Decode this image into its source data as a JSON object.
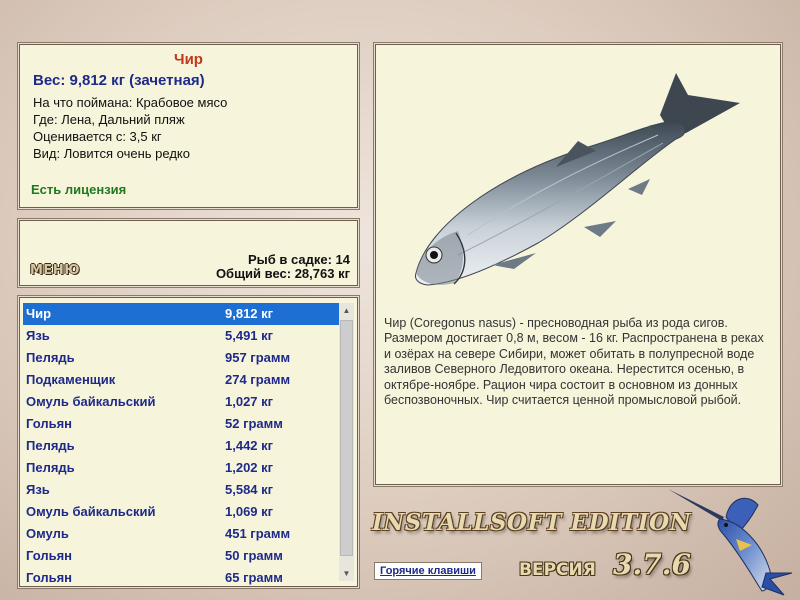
{
  "info": {
    "title": "Чир",
    "weight": "Вес: 9,812 кг (зачетная)",
    "bait": "На что поймана: Крабовое мясо",
    "location": "Где: Лена, Дальний пляж",
    "value": "Оценивается с: 3,5 кг",
    "rarity": "Вид: Ловится очень редко",
    "license": "Есть лицензия"
  },
  "stats": {
    "menu_label": "МЕНЮ",
    "fish_count": "Рыб в садке: 14",
    "total_weight": "Общий вес: 28,763 кг"
  },
  "catch_list": [
    {
      "name": "Чир",
      "weight": "9,812 кг",
      "selected": true
    },
    {
      "name": "Язь",
      "weight": "5,491 кг"
    },
    {
      "name": "Пелядь",
      "weight": "957 грамм"
    },
    {
      "name": "Подкаменщик",
      "weight": "274 грамм"
    },
    {
      "name": "Омуль байкальский",
      "weight": "1,027 кг"
    },
    {
      "name": "Гольян",
      "weight": "52 грамм"
    },
    {
      "name": "Пелядь",
      "weight": "1,442 кг"
    },
    {
      "name": "Пелядь",
      "weight": "1,202 кг"
    },
    {
      "name": "Язь",
      "weight": "5,584 кг"
    },
    {
      "name": "Омуль байкальский",
      "weight": "1,069 кг"
    },
    {
      "name": "Омуль",
      "weight": "451 грамм"
    },
    {
      "name": "Гольян",
      "weight": "50 грамм"
    },
    {
      "name": "Гольян",
      "weight": "65 грамм"
    }
  ],
  "description": "Чир (Coregonus nasus) - пресноводная рыба из рода сигов. Размером достигает 0,8 м, весом - 16 кг. Распространена в реках и озёрах на севере Сибири, может обитать в полупресной воде заливов Северного Ледовитого океана. Нерестится осенью, в октябре-ноябре. Рацион чира состоит в основном из донных беспозвоночных. Чир считается ценной промысловой рыбой.",
  "footer": {
    "brand": "INSTALLSOFT EDITION",
    "hotkeys_label": "Горячие клавиши",
    "version_label": "ВЕРСИЯ",
    "version_number": "3.7.6"
  },
  "icons": {
    "scroll_up": "scroll-up-arrow-icon",
    "scroll_down": "scroll-down-arrow-icon",
    "fish_image": "whitefish-image",
    "logo": "marlin-logo"
  },
  "colors": {
    "title": "#c0391a",
    "weight": "#1d2a8a",
    "license": "#1e7a1e",
    "selection": "#1e6fd3",
    "panel_bg": "#f7f4dc"
  }
}
